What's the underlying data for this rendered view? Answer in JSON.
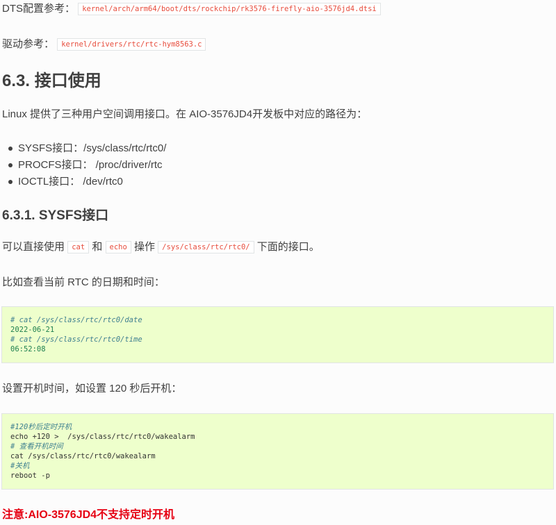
{
  "refs": {
    "dts_label": "DTS配置参考：",
    "dts_path": "kernel/arch/arm64/boot/dts/rockchip/rk3576-firefly-aio-3576jd4.dtsi",
    "driver_label": "驱动参考：",
    "driver_path": "kernel/drivers/rtc/rtc-hym8563.c"
  },
  "section": {
    "title": "6.3. 接口使用",
    "intro": "Linux 提供了三种用户空间调用接口。在 AIO-3576JD4开发板中对应的路径为：",
    "interfaces": [
      "SYSFS接口：/sys/class/rtc/rtc0/",
      "PROCFS接口： /proc/driver/rtc",
      "IOCTL接口： /dev/rtc0"
    ]
  },
  "subsection": {
    "title": "6.3.1. SYSFS接口",
    "usage_pre": "可以直接使用",
    "usage_cmd1": "cat",
    "usage_and": "和",
    "usage_cmd2": "echo",
    "usage_op": "操作",
    "usage_path": "/sys/class/rtc/rtc0/",
    "usage_post": "下面的接口。",
    "date_intro": "比如查看当前 RTC 的日期和时间：",
    "date_block": [
      {
        "kind": "comment",
        "text": "# cat /sys/class/rtc/rtc0/date"
      },
      {
        "kind": "output",
        "text": "2022-06-21"
      },
      {
        "kind": "comment",
        "text": "# cat /sys/class/rtc/rtc0/time"
      },
      {
        "kind": "output",
        "text": "06:52:08"
      }
    ],
    "alarm_intro": "设置开机时间，如设置 120 秒后开机：",
    "alarm_block": [
      {
        "kind": "comment",
        "text": "#120秒后定时开机"
      },
      {
        "kind": "plain",
        "text": "echo +120 >  /sys/class/rtc/rtc0/wakealarm"
      },
      {
        "kind": "comment",
        "text": "# 查看开机时间"
      },
      {
        "kind": "plain",
        "text": "cat /sys/class/rtc/rtc0/wakealarm"
      },
      {
        "kind": "comment",
        "text": "#关机"
      },
      {
        "kind": "plain",
        "text": "reboot -p"
      }
    ],
    "warning": "注意:AIO-3576JD4不支持定时开机"
  },
  "colors": {
    "code_text": "#e74c3c",
    "code_block_bg": "#eeffcc",
    "comment": "#408090",
    "output": "#208050",
    "warning": "#e60012"
  }
}
